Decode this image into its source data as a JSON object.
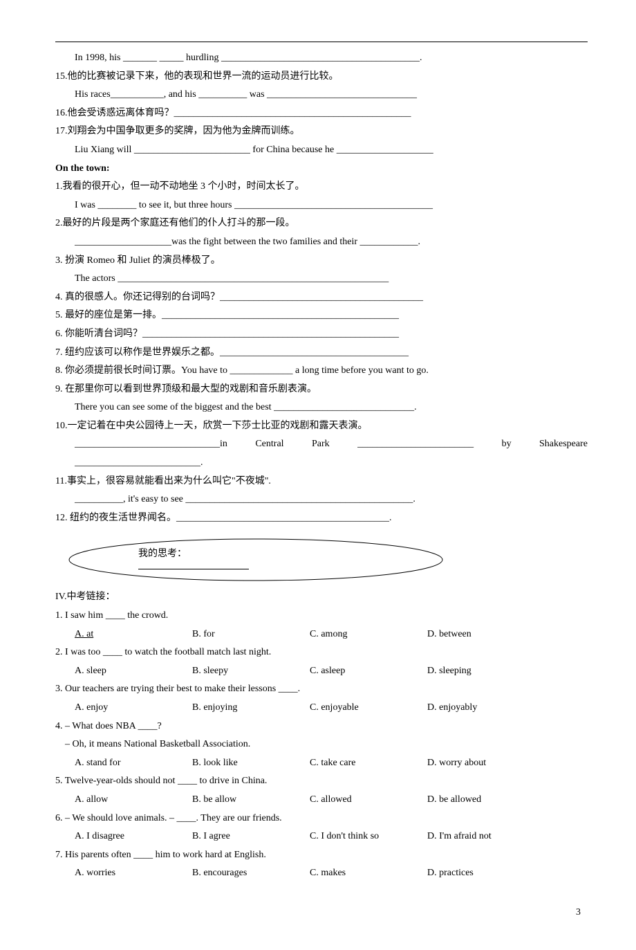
{
  "top": {
    "q14b": "In 1998, his _______  _____ hurdling _________________________________________.",
    "q15": "15.他的比赛被记录下来，他的表现和世界一流的运动员进行比较。",
    "q15b": "His races___________, and his __________ was _______________________________",
    "q16": "16.他会受诱惑远离体育吗？_________________________________________________",
    "q17": "17.刘翔会为中国争取更多的奖牌，因为他为金牌而训练。",
    "q17b": "Liu Xiang will ________________________ for China because he ____________________"
  },
  "section": "On the town:",
  "town": {
    "q1": "1.我看的很开心，但一动不动地坐 3 个小时，时间太长了。",
    "q1b": "I was ________ to see it, but three hours _________________________________________",
    "q2": "2.最好的片段是两个家庭还有他们的仆人打斗的那一段。",
    "q2b": "____________________was the fight between the two fami",
    "q2c": "lies and their ____________.",
    "q3": "3. 扮演 Romeo 和 Juliet 的演员棒极了。",
    "q3b": "The actors ________________________________________________________",
    "q4": "4. 真的很感人。你还记得别的台词吗？__________________________________________",
    "q5": "5. 最好的座位是第一排。_________________________________________________",
    "q6": "6. 你能听清台词吗？_____________________________________________________",
    "q7": "7. 纽约应该可以称作是世界娱乐之都。_______________________________________",
    "q8": "8. 你必须提前很长时间订票。You have to _____________ a long time before you want to go.",
    "q9": "9. 在那里你可以看到世界顶级和最大型的戏剧和音乐剧表演。",
    "q9b": "There you can see some of the biggest and the best _____________________________.",
    "q10": "10.一定记着在中央公园待上一天，欣赏一下莎士比亚的戏剧和露天表演。",
    "q10b_a": "______________________________in  Central  Park  ________________________  by  Shakespeare",
    "q10b_b": "__________________________.",
    "q11": "11.事实上，很容易就能看出来为什么叫它\"不夜城\".",
    "q11b": "__________, it's easy to see _______________________________________________.",
    "q12": "12. 纽约的夜生活世界闻名。____________________________________________."
  },
  "bubble": "我的思考：",
  "sec4": "IV.中考链接：",
  "m1": {
    "q": "1. I saw him ____ the crowd.",
    "a": "A. at",
    "b": "B. for",
    "c": "C. among",
    "d": "D. between"
  },
  "m2": {
    "q": "2. I was too ____ to watch the football match last night.",
    "a": "A. sleep",
    "b": "B. sleepy",
    "c": "C. asleep",
    "d": "D. sleeping"
  },
  "m3": {
    "q": "3. Our teachers are trying their best to make their lessons ____.",
    "a": "A. enjoy",
    "b": "B. enjoying",
    "c": "C. enjoyable",
    "d": "D. enjoyably"
  },
  "m4": {
    "q1": "4. – What does NBA ____?",
    "q2": "– Oh, it means National Basketball Association.",
    "a": "A. stand for",
    "b": "B. look like",
    "c": "C. take care",
    "d": "D. worry about"
  },
  "m5": {
    "q": "5. Twelve-year-olds should not ____ to drive in China.",
    "a": "A. allow",
    "b": "B. be allow",
    "c": "C. allowed",
    "d": "D. be allowed"
  },
  "m6": {
    "q": "6. – We should love animals.  – ____. They are our friends.",
    "a": "A. I disagree",
    "b": "B. I agree",
    "c": "C. I don't think so",
    "d": "D. I'm afraid not"
  },
  "m7": {
    "q": "7. His parents often ____ him to work hard at English.",
    "a": "A. worries",
    "b": "B. encourages",
    "c": "C. makes",
    "d": "D. practices"
  },
  "page": "3"
}
